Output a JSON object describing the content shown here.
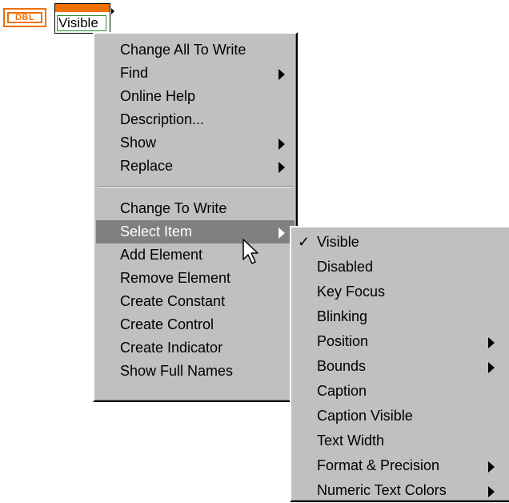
{
  "terminal": {
    "label": "DBL"
  },
  "node": {
    "label": "Visible"
  },
  "main_menu": {
    "group1": [
      {
        "label": "Change All To Write",
        "submenu": false
      },
      {
        "label": "Find",
        "submenu": true
      },
      {
        "label": "Online Help",
        "submenu": false
      },
      {
        "label": "Description...",
        "submenu": false
      },
      {
        "label": "Show",
        "submenu": true
      },
      {
        "label": "Replace",
        "submenu": true
      }
    ],
    "group2": [
      {
        "label": "Change To Write",
        "submenu": false
      },
      {
        "label": "Select Item",
        "submenu": true,
        "active": true
      },
      {
        "label": "Add Element",
        "submenu": false
      },
      {
        "label": "Remove Element",
        "submenu": false
      },
      {
        "label": "Create Constant",
        "submenu": false
      },
      {
        "label": "Create Control",
        "submenu": false
      },
      {
        "label": "Create Indicator",
        "submenu": false
      },
      {
        "label": "Show Full Names",
        "submenu": false
      }
    ]
  },
  "sub_menu": {
    "items": [
      {
        "label": "Visible",
        "checked": true,
        "submenu": false
      },
      {
        "label": "Disabled",
        "submenu": false
      },
      {
        "label": "Key Focus",
        "submenu": false
      },
      {
        "label": "Blinking",
        "submenu": false
      },
      {
        "label": "Position",
        "submenu": true
      },
      {
        "label": "Bounds",
        "submenu": true
      },
      {
        "label": "Caption",
        "submenu": false
      },
      {
        "label": "Caption Visible",
        "submenu": false
      },
      {
        "label": "Text Width",
        "submenu": false
      },
      {
        "label": "Format & Precision",
        "submenu": true
      },
      {
        "label": "Numeric Text Colors",
        "submenu": true
      }
    ],
    "check_glyph": "✓"
  },
  "colors": {
    "menu_bg": "#c0c0c0",
    "highlight": "#808080",
    "terminal_orange": "#f07000"
  }
}
